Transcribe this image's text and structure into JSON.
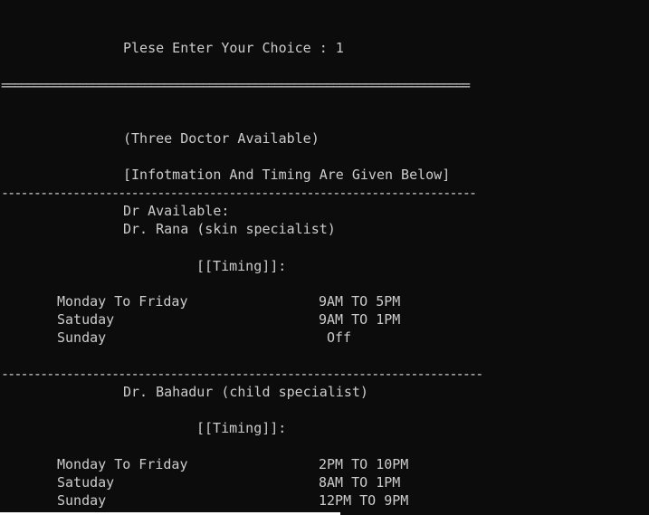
{
  "console": {
    "prompt": "Plese Enter Your Choice : 1",
    "separator_double": "========================================================================",
    "three_doctor": "(Three Doctor Available)",
    "info_timing": "[Infotmation And Timing Are Given Below]",
    "separator_dash_1": "-------------------------------------------------------------------------",
    "dr_available": "Dr Available:",
    "doctor_1": {
      "name": "Dr. Rana (skin specialist)",
      "timing_label": "[[Timing]]:",
      "schedule": [
        {
          "day": "Monday To Friday",
          "time": "9AM TO 5PM"
        },
        {
          "day": "Satuday",
          "time": "9AM TO 1PM"
        },
        {
          "day": "Sunday",
          "time": "Off"
        }
      ]
    },
    "separator_dash_2": "--------------------------------------------------------------------------",
    "doctor_2": {
      "name": "Dr. Bahadur (child specialist)",
      "timing_label": "[[Timing]]:",
      "schedule": [
        {
          "day": "Monday To Friday",
          "time": "2PM TO 10PM"
        },
        {
          "day": "Satuday",
          "time": "8AM TO 1PM"
        },
        {
          "day": "Sunday",
          "time": "12PM TO 9PM"
        }
      ]
    }
  }
}
